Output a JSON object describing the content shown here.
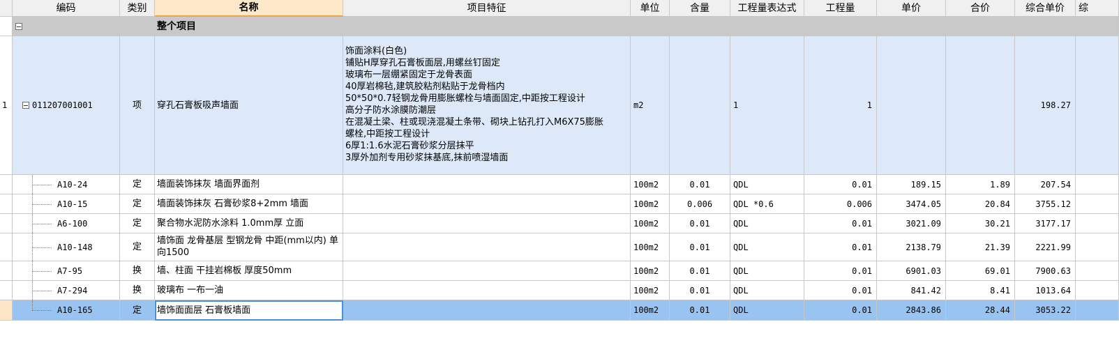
{
  "headers": {
    "code": "编码",
    "type": "类别",
    "name": "名称",
    "features": "项目特征",
    "unit": "单位",
    "content": "含量",
    "expr": "工程量表达式",
    "qty": "工程量",
    "price": "单价",
    "total": "合价",
    "comp_price": "综合单价",
    "extra": "综"
  },
  "group_row": {
    "title": "整个项目"
  },
  "main_row": {
    "index": "1",
    "code": "011207001001",
    "type": "项",
    "name": "穿孔石膏板吸声墙面",
    "features": [
      "饰面涂料(白色)",
      "铺贴H厚穿孔石膏板面层,用螺丝钉固定",
      "玻璃布一层绷紧固定于龙骨表面",
      "40厚岩棉毡,建筑胶粘剂粘贴于龙骨档内",
      "50*50*0.7轻钢龙骨用膨胀螺栓与墙面固定,中距按工程设计",
      "高分子防水涂膜防潮层",
      "在混凝土梁、柱或现浇混凝土条带、砌块上钻孔打入M6X75膨胀",
      "螺栓,中距按工程设计",
      "6厚1:1.6水泥石膏砂浆分层抹平",
      "3厚外加剂专用砂浆抹基底,抹前喷湿墙面"
    ],
    "unit": "m2",
    "content": "",
    "expr": "1",
    "qty": "1",
    "price": "",
    "total": "",
    "comp_price": "198.27"
  },
  "rows": [
    {
      "code": "A10-24",
      "type": "定",
      "name": "墙面装饰抹灰 墙面界面剂",
      "unit": "100m2",
      "content": "0.01",
      "expr": "QDL",
      "qty": "0.01",
      "price": "189.15",
      "total": "1.89",
      "comp_price": "207.54"
    },
    {
      "code": "A10-15",
      "type": "定",
      "name": "墙面装饰抹灰 石膏砂浆8+2mm 墙面",
      "unit": "100m2",
      "content": "0.006",
      "expr": "QDL *0.6",
      "qty": "0.006",
      "price": "3474.05",
      "total": "20.84",
      "comp_price": "3755.12"
    },
    {
      "code": "A6-100",
      "type": "定",
      "name": "聚合物水泥防水涂料 1.0mm厚 立面",
      "unit": "100m2",
      "content": "0.01",
      "expr": "QDL",
      "qty": "0.01",
      "price": "3021.09",
      "total": "30.21",
      "comp_price": "3177.17"
    },
    {
      "code": "A10-148",
      "type": "定",
      "name": "墙饰面 龙骨基层 型钢龙骨 中距(mm以内) 单向1500",
      "unit": "100m2",
      "content": "0.01",
      "expr": "QDL",
      "qty": "0.01",
      "price": "2138.79",
      "total": "21.39",
      "comp_price": "2221.99"
    },
    {
      "code": "A7-95",
      "type": "换",
      "name": "墙、柱面 干挂岩棉板 厚度50mm",
      "unit": "100m2",
      "content": "0.01",
      "expr": "QDL",
      "qty": "0.01",
      "price": "6901.03",
      "total": "69.01",
      "comp_price": "7900.63"
    },
    {
      "code": "A7-294",
      "type": "换",
      "name": "玻璃布 一布一油",
      "unit": "100m2",
      "content": "0.01",
      "expr": "QDL",
      "qty": "0.01",
      "price": "841.42",
      "total": "8.41",
      "comp_price": "1013.64"
    },
    {
      "code": "A10-165",
      "type": "定",
      "name": "墙饰面面层 石膏板墙面",
      "unit": "100m2",
      "content": "0.01",
      "expr": "QDL",
      "qty": "0.01",
      "price": "2843.86",
      "total": "28.44",
      "comp_price": "3053.22"
    }
  ],
  "colors": {
    "header_bg": "#f0f0f0",
    "name_header_bg": "#fde9c9",
    "group_bg": "#c9c9c9",
    "main_bg": "#dde8f8",
    "selected_bg": "#99c4f2"
  }
}
